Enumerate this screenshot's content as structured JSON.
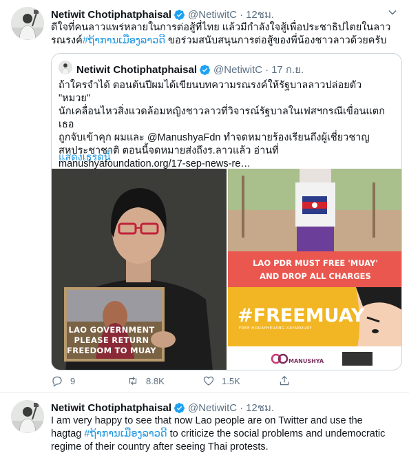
{
  "tweet1": {
    "author": {
      "name": "Netiwit Chotiphatphaisal",
      "handle": "@NetiwitC",
      "separator": "·",
      "time": "12ชม."
    },
    "text_line1": "ดีใจที่คนลาวแพร่หลายในการต่อสู้ที่ไทย แล้วมีกำลังใจสู้เพื่อประชาธิปไตยในลาว รณรงค์",
    "hashtag": "#ຖ້າການເມືອງລາວດີ",
    "text_line2_rest": " ขอร่วมสนับสนุนการต่อสู้ของพี่น้องชาวลาวด้วยครับ",
    "quote": {
      "author": {
        "name": "Netiwit Chotiphatphaisal",
        "handle": "@NetiwitC",
        "separator": "·",
        "time": "17 ก.ย."
      },
      "lines": [
        "ถ้าใครจำได้ ตอนต้นปีผมได้เขียนบทความรณรงค์ให้รัฐบาลลาวปล่อยตัว \"หมวย\"",
        "นักเคลื่อนไหวสิ่งแวดล้อมหญิงชาวลาวที่วิจารณ์รัฐบาลในเฟสฯกรณีเขื่อนแตก เธอ",
        "ถูกจับเข้าคุก ผมและ @ManushyaFdn ทำจดหมายร้องเรียนถึงผู้เชี่ยวชาญ",
        "สหประชาชาติ ตอนนี้จดหมายส่งถึงร.ลาวแล้ว อ่านที่",
        "manushyafoundation.org/17-sep-news-re…"
      ],
      "show_thread": "แสดงเธรดนี้",
      "media": {
        "sign_lines": [
          "LAO GOVERNMENT",
          "PLEASE RETURN",
          "FREEDOM TO MUAY"
        ],
        "banner_lines": [
          "LAO PDR MUST FREE 'MUAY'",
          "AND DROP ALL CHARGES"
        ],
        "hashtag_big": "#FREEMUAY",
        "hashtag_sub": "FREE HOUAYHEUANG XAYABOURY",
        "brand": "MANUSHYA"
      }
    },
    "actions": {
      "replies": "9",
      "retweets": "8.8K",
      "likes": "1.5K"
    }
  },
  "tweet2": {
    "author": {
      "name": "Netiwit Chotiphatphaisal",
      "handle": "@NetiwitC",
      "separator": "·",
      "time": "12ชม."
    },
    "line1": "I am very happy to see that now Lao people are on Twitter and use the",
    "line2_pre": "hagtag ",
    "hashtag": "#ຖ້າການເມືອງລາວດີ",
    "line2_post": " to criticize the social problems and undemocratic",
    "line3": "regime of their country after seeing Thai protests."
  },
  "colors": {
    "link": "#1b95e0",
    "muted": "#5b7083",
    "verified": "#1da1f2",
    "banner": "#e9574f",
    "freemuay_bg": "#f2b624"
  }
}
